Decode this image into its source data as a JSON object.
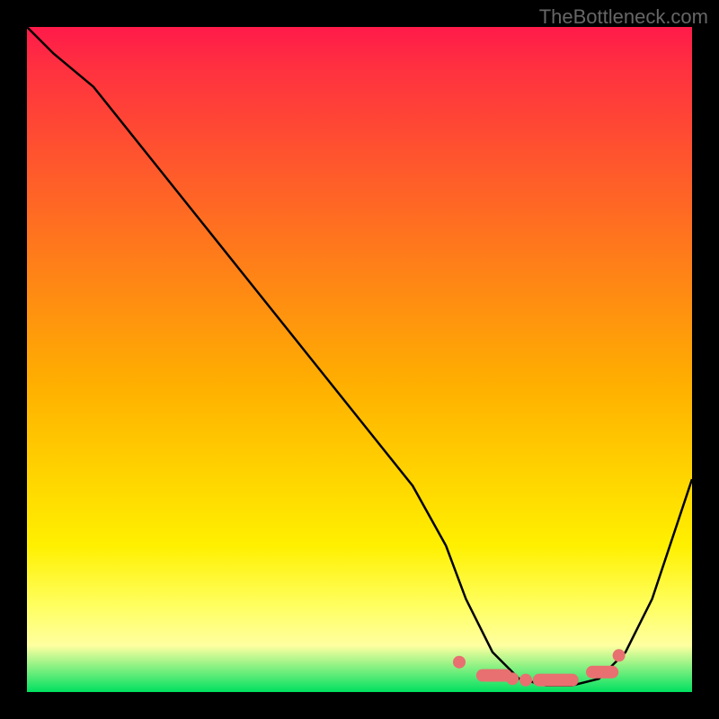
{
  "watermark": "TheBottleneck.com",
  "chart_data": {
    "type": "line",
    "title": "",
    "xlabel": "",
    "ylabel": "",
    "xlim": [
      0,
      100
    ],
    "ylim": [
      0,
      100
    ],
    "grid": false,
    "series": [
      {
        "name": "bottleneck-curve",
        "x": [
          0,
          4,
          10,
          18,
          26,
          34,
          42,
          50,
          58,
          63,
          66,
          70,
          74,
          78,
          82,
          86,
          90,
          94,
          100
        ],
        "y": [
          100,
          96,
          91,
          81,
          71,
          61,
          51,
          41,
          31,
          22,
          14,
          6,
          2,
          1,
          1,
          2,
          6,
          14,
          32
        ]
      }
    ],
    "markers": [
      {
        "x": 65,
        "y": 4.5,
        "kind": "dot"
      },
      {
        "x": 68.5,
        "y": 2.5,
        "kind": "segment",
        "x2": 72
      },
      {
        "x": 73,
        "y": 2.0,
        "kind": "dot"
      },
      {
        "x": 75,
        "y": 1.8,
        "kind": "dot"
      },
      {
        "x": 77,
        "y": 1.8,
        "kind": "segment",
        "x2": 82
      },
      {
        "x": 85,
        "y": 3.0,
        "kind": "segment",
        "x2": 88
      },
      {
        "x": 89,
        "y": 5.5,
        "kind": "dot"
      }
    ],
    "gradient_stops": [
      {
        "offset": 0,
        "color": "#ff1a4a"
      },
      {
        "offset": 50,
        "color": "#ffb000"
      },
      {
        "offset": 90,
        "color": "#ffff80"
      },
      {
        "offset": 100,
        "color": "#00e060"
      }
    ],
    "marker_color": "#e87070"
  }
}
